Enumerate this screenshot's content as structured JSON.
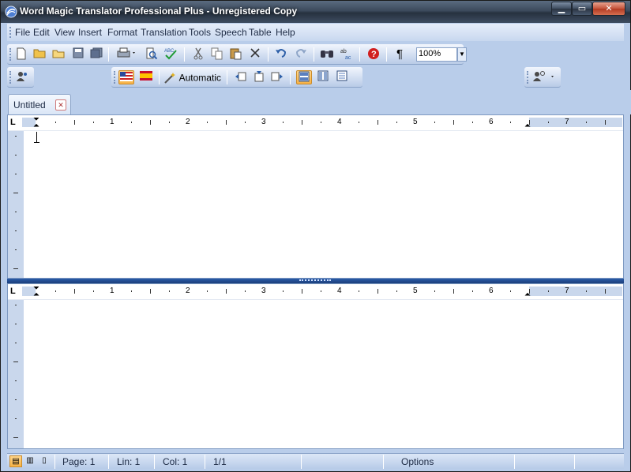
{
  "window": {
    "title": "Word Magic Translator Professional Plus - Unregistered Copy",
    "min_glyph": "▁",
    "max_glyph": "▭",
    "close_glyph": "✕"
  },
  "menubar": {
    "items": [
      "File",
      "Edit",
      "View",
      "Insert",
      "Format",
      "Translation",
      "Tools",
      "Speech",
      "Table",
      "Help"
    ]
  },
  "toolbar_standard": {
    "zoom_value": "100%",
    "pilcrow": "¶"
  },
  "toolbar_translation": {
    "mode_label": "Automatic"
  },
  "tabs": [
    {
      "label": "Untitled",
      "close_glyph": "⊠"
    }
  ],
  "ruler": {
    "tab_stop_glyph": "L",
    "labels": [
      "1",
      "2",
      "3",
      "4",
      "5",
      "6",
      "7"
    ]
  },
  "statusbar": {
    "page": "Page:  1",
    "line": "Lin:  1",
    "col": "Col:  1",
    "page_count": "1/1",
    "options": "Options"
  },
  "colors": {
    "chrome_bg": "#b9cdea",
    "splitter": "#2a5ba8",
    "active_button": "#f7b246"
  }
}
